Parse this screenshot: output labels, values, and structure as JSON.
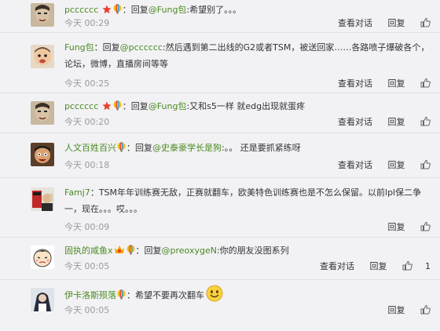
{
  "actions": {
    "view_conversation": "查看对话",
    "reply": "回复"
  },
  "colon": "：",
  "comments": [
    {
      "user": "pcccccc",
      "badges": [
        "star-badge-icon",
        "balloon-badge-icon"
      ],
      "text_prefix": "回复",
      "mention": "@Fung包",
      "text": ":希望别了。。。",
      "time": "今天 00:29",
      "like_count": ""
    },
    {
      "user": "Fung包",
      "badges": [],
      "text_prefix": "回复",
      "mention": "@pcccccc",
      "text": ":然后遇到第二出线的G2或者TSM，被送回家……各路喷子爆破各个，论坛，微博，直播房间等等",
      "time": "今天 00:25",
      "like_count": ""
    },
    {
      "user": "pcccccc",
      "badges": [
        "star-badge-icon",
        "balloon-badge-icon"
      ],
      "text_prefix": "回复",
      "mention": "@Fung包",
      "text": ":又和s5一样 就edg出现就蛋疼",
      "time": "今天 00:20",
      "like_count": ""
    },
    {
      "user": "人文百姓百兴",
      "badges": [
        "balloon-badge-icon"
      ],
      "text_prefix": "回复",
      "mention": "@史泰豪学长是狗",
      "text": ":。。 还是要抓紧练呀",
      "time": "今天 00:18",
      "like_count": ""
    },
    {
      "user": "Famj7",
      "badges": [],
      "text_prefix": "",
      "mention": "",
      "text": "TSM年年训练赛无敌，正赛就翻车，欧美特色训练赛也是不怎么保留。以前lpl保二争一，现在。。。哎。。。",
      "time": "今天 00:09",
      "like_count": ""
    },
    {
      "user": "固执的咸鱼x",
      "badges": [
        "vip-badge-icon",
        "balloon-badge-icon"
      ],
      "text_prefix": "回复",
      "mention": "@preoxygeN",
      "text": ":你的朋友没图系列",
      "time": "今天 00:05",
      "like_count": "1"
    },
    {
      "user": "伊卡洛斯殒落",
      "badges": [
        "balloon-badge-icon"
      ],
      "text_prefix": "",
      "mention": "",
      "text": "希望不要再次翻车",
      "time": "今天 00:05",
      "like_count": ""
    }
  ]
}
